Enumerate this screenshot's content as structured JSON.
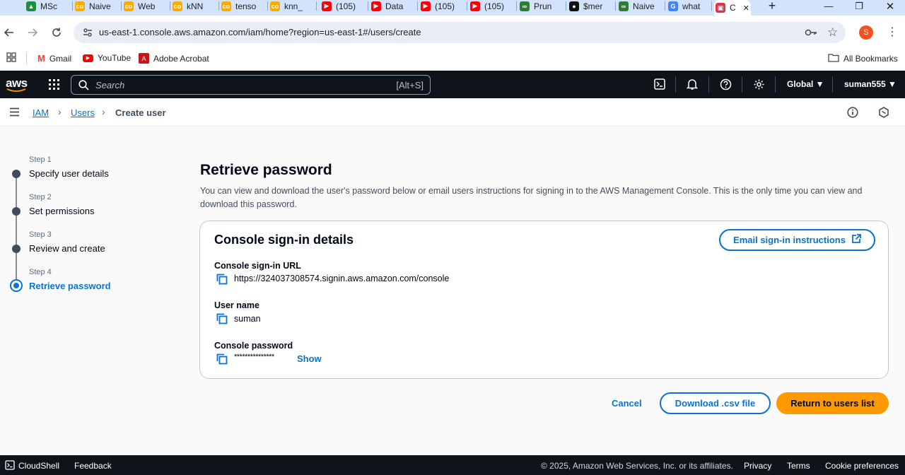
{
  "browser": {
    "tabs": [
      {
        "label": "MSc",
        "fav_color": "#1e8e3e",
        "fav_glyph": "▲"
      },
      {
        "label": "Naive",
        "fav_color": "#f9ab00",
        "fav_glyph": "co"
      },
      {
        "label": "Web",
        "fav_color": "#f9ab00",
        "fav_glyph": "co"
      },
      {
        "label": "kNN",
        "fav_color": "#f9ab00",
        "fav_glyph": "co"
      },
      {
        "label": "tenso",
        "fav_color": "#f9ab00",
        "fav_glyph": "co"
      },
      {
        "label": "knn_",
        "fav_color": "#f9ab00",
        "fav_glyph": "co"
      },
      {
        "label": "(105)",
        "fav_color": "#ff0000",
        "fav_glyph": "▶"
      },
      {
        "label": "Data",
        "fav_color": "#ff0000",
        "fav_glyph": "▶"
      },
      {
        "label": "(105)",
        "fav_color": "#ff0000",
        "fav_glyph": "▶"
      },
      {
        "label": "(105)",
        "fav_color": "#ff0000",
        "fav_glyph": "▶"
      },
      {
        "label": "Prun",
        "fav_color": "#2e7d32",
        "fav_glyph": "∞"
      },
      {
        "label": "$mer",
        "fav_color": "#111111",
        "fav_glyph": "●"
      },
      {
        "label": "Naive",
        "fav_color": "#2e7d32",
        "fav_glyph": "∞"
      },
      {
        "label": "what",
        "fav_color": "#4285f4",
        "fav_glyph": "G"
      },
      {
        "label": "C",
        "fav_color": "#dd344c",
        "fav_glyph": "▣"
      }
    ],
    "url": "us-east-1.console.aws.amazon.com/iam/home?region=us-east-1#/users/create",
    "avatar_letter": "S",
    "bookmarks": [
      {
        "label": "Gmail"
      },
      {
        "label": "YouTube"
      },
      {
        "label": "Adobe Acrobat"
      }
    ],
    "all_bookmarks": "All Bookmarks"
  },
  "awsnav": {
    "logo": "aws",
    "search_placeholder": "Search",
    "search_shortcut": "[Alt+S]",
    "region": "Global ▼",
    "account": "suman555 ▼"
  },
  "breadcrumb": {
    "iam": "IAM",
    "users": "Users",
    "current": "Create user"
  },
  "steps": [
    {
      "num": "Step 1",
      "label": "Specify user details"
    },
    {
      "num": "Step 2",
      "label": "Set permissions"
    },
    {
      "num": "Step 3",
      "label": "Review and create"
    },
    {
      "num": "Step 4",
      "label": "Retrieve password"
    }
  ],
  "page": {
    "title": "Retrieve password",
    "description": "You can view and download the user's password below or email users instructions for signing in to the AWS Management Console. This is the only time you can view and download this password."
  },
  "card": {
    "title": "Console sign-in details",
    "email_button": "Email sign-in instructions",
    "url_label": "Console sign-in URL",
    "url_value": "https://324037308574.signin.aws.amazon.com/console",
    "username_label": "User name",
    "username_value": "suman",
    "password_label": "Console password",
    "password_value": "***************",
    "show_link": "Show"
  },
  "actions": {
    "cancel": "Cancel",
    "download": "Download .csv file",
    "return": "Return to users list"
  },
  "footer": {
    "cloudshell": "CloudShell",
    "feedback": "Feedback",
    "copyright": "© 2025, Amazon Web Services, Inc. or its affiliates.",
    "privacy": "Privacy",
    "terms": "Terms",
    "cookie": "Cookie preferences"
  },
  "colors": {
    "link": "#0972d3",
    "primary_button": "#ff9900",
    "nav_bg": "#0f141a"
  }
}
